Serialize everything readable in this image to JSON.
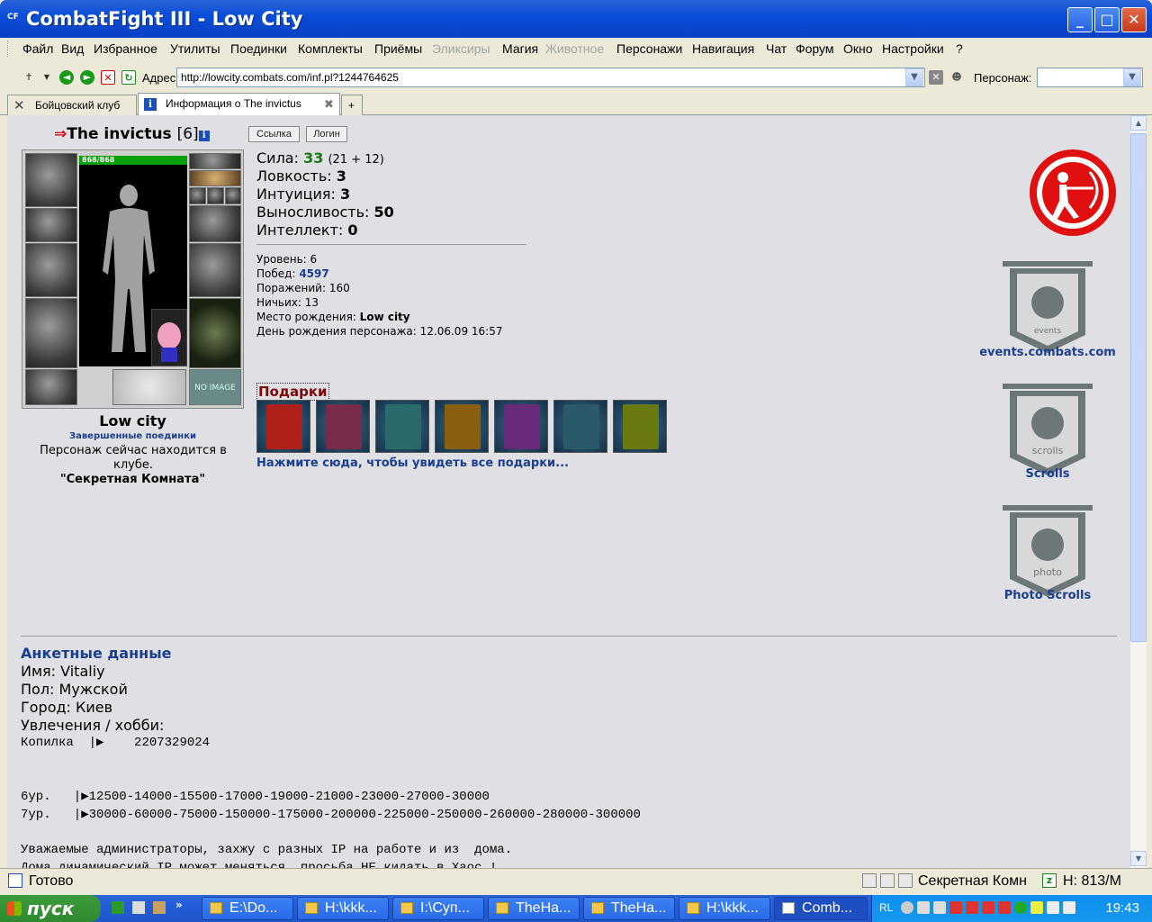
{
  "window": {
    "title": "CombatFight III - Low City",
    "icon_text": "CF"
  },
  "menu": {
    "items": [
      {
        "label": "Файл",
        "enabled": true
      },
      {
        "label": "Вид",
        "enabled": true
      },
      {
        "label": "Избранное",
        "enabled": true
      },
      {
        "label": "Утилиты",
        "enabled": true
      },
      {
        "label": "Поединки",
        "enabled": true
      },
      {
        "label": "Комплекты",
        "enabled": true
      },
      {
        "label": "Приёмы",
        "enabled": true
      },
      {
        "label": "Эликсиры",
        "enabled": false
      },
      {
        "label": "Магия",
        "enabled": true
      },
      {
        "label": "Животное",
        "enabled": false
      },
      {
        "label": "Персонажи",
        "enabled": true
      },
      {
        "label": "Навигация",
        "enabled": true
      },
      {
        "label": "Чат",
        "enabled": true
      },
      {
        "label": "Форум",
        "enabled": true
      },
      {
        "label": "Окно",
        "enabled": true
      },
      {
        "label": "Настройки",
        "enabled": true
      },
      {
        "label": "?",
        "enabled": true
      }
    ]
  },
  "toolbar": {
    "address_label": "Адрес",
    "address_value": "http://lowcity.combats.com/inf.pl?1244764625",
    "character_label": "Персонаж:",
    "character_value": ""
  },
  "tabs": [
    {
      "label": "Бойцовский клуб",
      "active": false
    },
    {
      "label": "Информация о The invictus",
      "active": true
    }
  ],
  "profile": {
    "arrow": "⇒",
    "nick": "The invictus",
    "level_display": "[6]",
    "info_icon": "i",
    "btn_link": "Ссылка",
    "btn_login": "Логин",
    "hp_text": "868/868",
    "hp_fraction": 1.0,
    "no_image_text": "NO IMAGE",
    "city": "Low city",
    "finished_fights": "Завершенные поединки",
    "location_text": "Персонаж сейчас находится в клубе.",
    "room": "\"Секретная Комната\""
  },
  "stats": {
    "strength_label": "Сила:",
    "strength_value": "33",
    "strength_extra": "(21 + 12)",
    "agility_label": "Ловкость:",
    "agility_value": "3",
    "intuition_label": "Интуиция:",
    "intuition_value": "3",
    "endurance_label": "Выносливость:",
    "endurance_value": "50",
    "intellect_label": "Интеллект:",
    "intellect_value": "0"
  },
  "record": {
    "level_label": "Уровень:",
    "level_value": "6",
    "wins_label": "Побед:",
    "wins_value": "4597",
    "losses_label": "Поражений:",
    "losses_value": "160",
    "draws_label": "Ничьих:",
    "draws_value": "13",
    "birthplace_label": "Место рождения:",
    "birthplace_value": "Low city",
    "birthday_label": "День рождения персонажа:",
    "birthday_value": "12.06.09 16:57"
  },
  "gifts": {
    "title": "Подарки",
    "count_shown": 7,
    "colors": [
      "#b0201a",
      "#7a2a4a",
      "#2a6a6a",
      "#8a6010",
      "#6a2a7a",
      "#2a5a6a",
      "#6a7a10"
    ],
    "see_all": "Нажмите сюда, чтобы увидеть все подарки..."
  },
  "right_panel": {
    "events_label": "events.combats.com",
    "events_banner_text": "events",
    "scrolls_label": "Scrolls",
    "scrolls_banner_text": "scrolls",
    "photo_label": "Photo Scrolls",
    "photo_banner_text": "photo"
  },
  "anketa": {
    "title": "Анкетные данные",
    "name_line": "Имя: Vitaliy",
    "gender_line": "Пол: Мужской",
    "city_line": "Город: Киев",
    "hobby_line": "Увлечения / хобби:",
    "piggy_line": "Копилка  |▶    2207329024",
    "lvl6_line": "6ур.   |▶12500-14000-15500-17000-19000-21000-23000-27000-30000",
    "lvl7_line": "7ур.   |▶30000-60000-75000-150000-175000-200000-225000-250000-260000-280000-300000",
    "note_line1": "Уважаемые администраторы, захжу с разных IP на работе и из  дома.",
    "note_line2": "Дома динамический IP может меняться, просьба НЕ кидать в Хаос !"
  },
  "status": {
    "ready": "Готово",
    "room": "Секретная Комн",
    "hp": "H: 813/M"
  },
  "taskbar": {
    "start": "пуск",
    "tasks": [
      {
        "label": "E:\\Do...",
        "active": false
      },
      {
        "label": "H:\\kkk...",
        "active": false
      },
      {
        "label": "I:\\Суп...",
        "active": false
      },
      {
        "label": "TheHa...",
        "active": false
      },
      {
        "label": "TheHa...",
        "active": false
      },
      {
        "label": "H:\\kkk...",
        "active": false
      },
      {
        "label": "Comb...",
        "active": true
      }
    ],
    "lang": "RL",
    "clock": "19:43"
  },
  "colors": {
    "titlebar": "#0a4ed8",
    "page_bg": "#e0dfe3",
    "link_blue": "#1b3f8f",
    "strength_green": "#1a7a1a",
    "gift_title": "#7a0a0a",
    "banner_gray": "#6e7777",
    "archer_red": "#e01010"
  }
}
